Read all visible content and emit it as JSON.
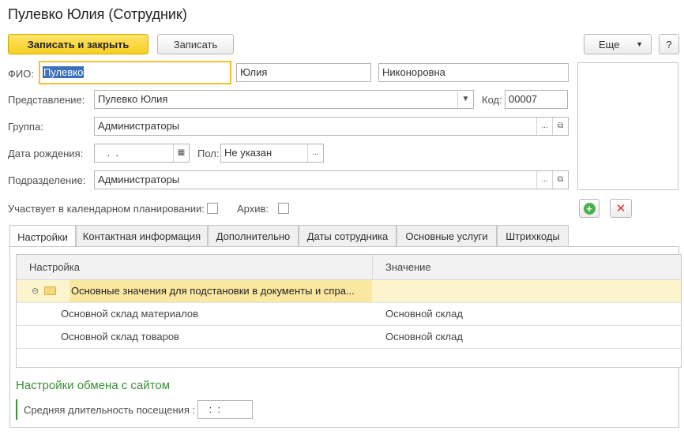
{
  "window": {
    "title": "Пулевко Юлия (Сотрудник)"
  },
  "toolbar": {
    "save_close_label": "Записать и закрыть",
    "save_label": "Записать",
    "more_label": "Еще",
    "help_label": "?"
  },
  "form": {
    "fio_label": "ФИО:",
    "last_name": "Пулевко",
    "first_name": "Юлия",
    "middle_name": "Никоноровна",
    "representation_label": "Представление:",
    "representation_value": "Пулевко Юлия",
    "code_label": "Код:",
    "code_value": "00007",
    "group_label": "Группа:",
    "group_value": "Администраторы",
    "birthdate_label": "Дата рождения:",
    "birthdate_value": " .  .",
    "gender_label": "Пол:",
    "gender_value": "Не указан",
    "department_label": "Подразделение:",
    "department_value": "Администраторы",
    "calendar_label": "Участвует в календарном планировании:",
    "calendar_checked": false,
    "archive_label": "Архив:",
    "archive_checked": false
  },
  "tabs": [
    {
      "label": "Настройки",
      "active": true
    },
    {
      "label": "Контактная информация",
      "active": false
    },
    {
      "label": "Дополнительно",
      "active": false
    },
    {
      "label": "Даты сотрудника",
      "active": false
    },
    {
      "label": "Основные услуги",
      "active": false
    },
    {
      "label": "Штрихкоды",
      "active": false
    }
  ],
  "settings_table": {
    "columns": [
      "Настройка",
      "Значение"
    ],
    "group_row": "Основные значения для подстановки в документы и спра...",
    "rows": [
      {
        "setting": "Основной склад материалов",
        "value": "Основной склад"
      },
      {
        "setting": "Основной склад товаров",
        "value": "Основной склад"
      }
    ]
  },
  "site_exchange": {
    "heading": "Настройки обмена с сайтом",
    "avg_visit_label": "Средняя длительность посещения :",
    "avg_visit_value": " :  :"
  },
  "colors": {
    "primary_button": "#f8cf21",
    "focus_border": "#f2c230",
    "selection": "#3c6fbe",
    "group_row_bg": "#fbf4cc",
    "section_heading": "#3a8f3a",
    "add_icon": "#4caf50",
    "delete_icon": "#d9372b"
  },
  "icons": [
    "dropdown-arrow-icon",
    "select-ellipsis-icon",
    "open-form-icon",
    "calendar-icon",
    "add-photo-icon",
    "delete-photo-icon",
    "collapse-minus-icon",
    "folder-icon"
  ]
}
